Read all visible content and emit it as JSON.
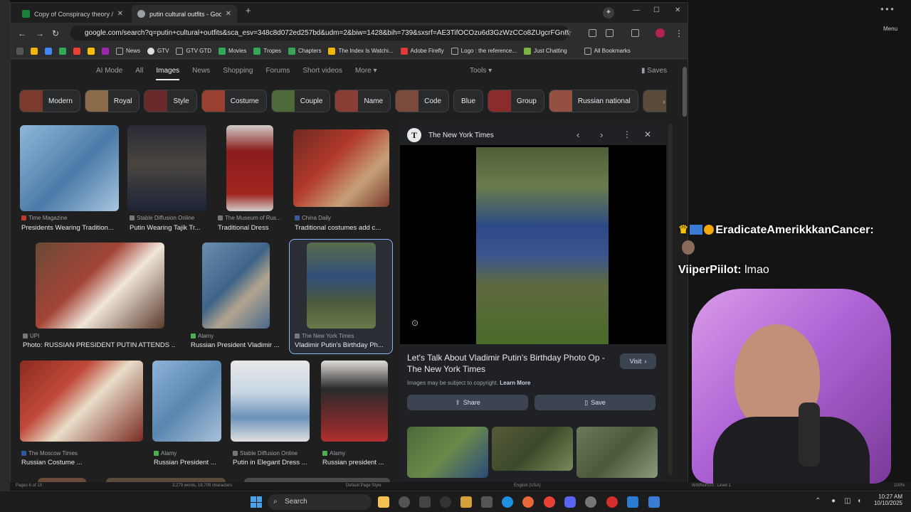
{
  "tabs": [
    {
      "title": "Copy of Conspiracy theory / tro",
      "favicon_color": "#188038"
    },
    {
      "title": "putin cultural outfits - Google S",
      "favicon_color": "#9aa0a6"
    }
  ],
  "address": "google.com/search?q=putin+cultural+outfits&sca_esv=348c8d072ed257bd&udm=2&biw=1428&bih=739&sxsrf=AE3TifOCOzu6d3GzWzCCo8ZUgcrFGnIVoQ%...",
  "bookmarks": [
    "News",
    "GTV",
    "GTV GTD",
    "Movies",
    "Tropes",
    "Chapters",
    "The Index Is Watchi...",
    "Adobe Firefly",
    "Logo : the reference...",
    "Just Chatting",
    "All Bookmarks"
  ],
  "google": {
    "tabs": [
      "AI Mode",
      "All",
      "Images",
      "News",
      "Shopping",
      "Forums",
      "Short videos",
      "More"
    ],
    "tools": "Tools",
    "saves": "Saves",
    "chips": [
      "Modern",
      "Royal",
      "Style",
      "Costume",
      "Couple",
      "Name",
      "Code",
      "Blue",
      "Group",
      "Russian national",
      "Mi"
    ],
    "results": [
      {
        "source": "Time Magazine",
        "caption": "Presidents Wearing Tradition..."
      },
      {
        "source": "Stable Diffusion Online",
        "caption": "Putin Wearing Tajik Tr..."
      },
      {
        "source": "The Museum of Rus...",
        "caption": "Traditional Dress"
      },
      {
        "source": "China Daily",
        "caption": "Traditional costumes add c..."
      },
      {
        "source": "UPI",
        "caption": "Photo: RUSSIAN PRESIDENT PUTIN ATTENDS ..."
      },
      {
        "source": "Alamy",
        "caption": "Russian President Vladimir ..."
      },
      {
        "source": "The New York Times",
        "caption": "Vladimir Putin's Birthday Ph..."
      },
      {
        "source": "The Moscow Times",
        "caption": "Russian Costume ..."
      },
      {
        "source": "Alamy",
        "caption": "Russian President ..."
      },
      {
        "source": "Stable Diffusion Online",
        "caption": "Putin in Elegant Dress ..."
      },
      {
        "source": "Alamy",
        "caption": "Russian president ..."
      }
    ]
  },
  "panel": {
    "source": "The New York Times",
    "title": "Let's Talk About Vladimir Putin's Birthday Photo Op - The New York Times",
    "visit": "Visit",
    "copyright": "Images may be subject to copyright.",
    "learn_more": "Learn More",
    "share": "Share",
    "save": "Save"
  },
  "chat": [
    {
      "user": "EradicateAmerikkkanCancer:",
      "message": ""
    },
    {
      "user": "ViiperPiilot:",
      "message": "lmao"
    }
  ],
  "docs_status": {
    "pages": "Pages 6 of 10",
    "words": "3,279 words, 19,709 characters",
    "style": "Default Page Style",
    "lang": "English (USA)",
    "num": "WWNum10 : Level 1",
    "zoom": "100%"
  },
  "rightwin": {
    "menu": "Menu"
  },
  "taskbar": {
    "search": "Search",
    "time": "10:27 AM",
    "date": "10/10/2025"
  }
}
